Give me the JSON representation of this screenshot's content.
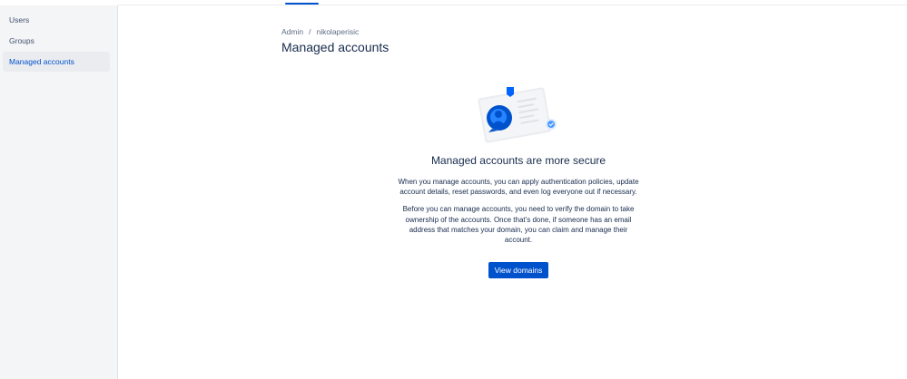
{
  "sidebar": {
    "items": [
      {
        "label": "Users"
      },
      {
        "label": "Groups"
      },
      {
        "label": "Managed accounts",
        "active": true
      }
    ]
  },
  "breadcrumb": {
    "items": [
      "Admin",
      "nikolaperisic"
    ],
    "separator": "/"
  },
  "main": {
    "title": "Managed accounts",
    "illustration_icon": "id-card-shield-illustration",
    "heading": "Managed accounts are more secure",
    "paragraph_1": "When you manage accounts, you can apply authentication policies, update account details, reset passwords, and even log everyone out if necessary.",
    "paragraph_2": "Before you can manage accounts, you need to verify the domain to take ownership of the accounts. Once that’s done, if someone has an email address that matches your domain, you can claim and manage their account.",
    "button_label": "View domains"
  },
  "colors": {
    "primary": "#0052cc",
    "sidebar_bg": "#f4f5f7",
    "text": "#172b4d",
    "subtle_text": "#5e6c84"
  }
}
